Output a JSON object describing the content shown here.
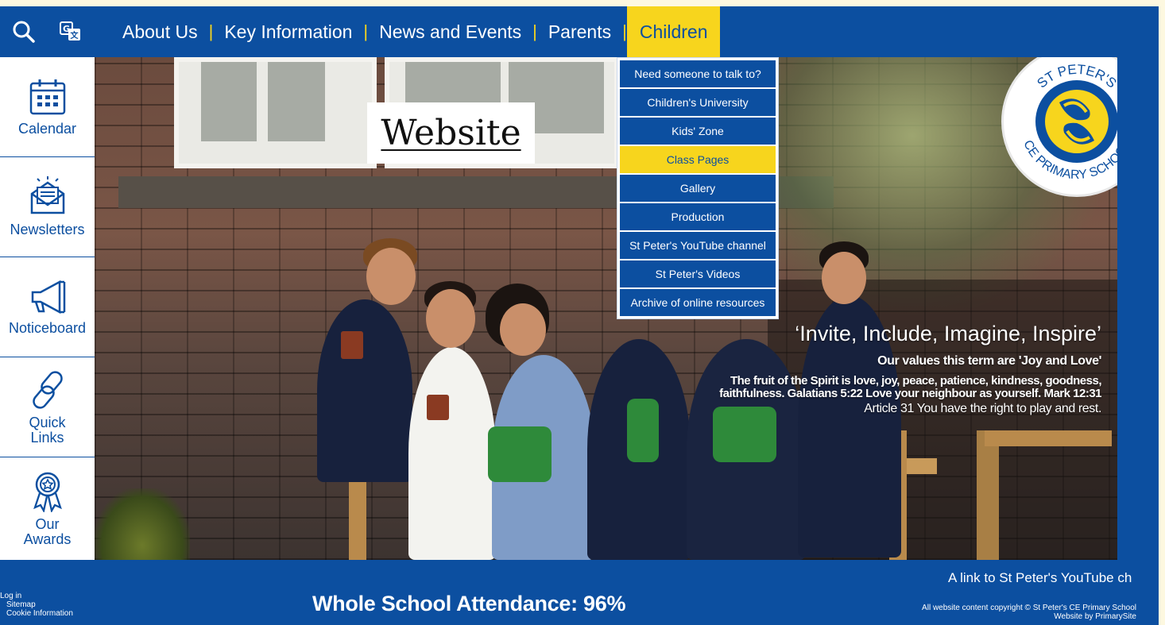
{
  "toolbar": {
    "search_icon": "search-icon",
    "translate_icon": "translate-icon"
  },
  "nav": {
    "items": [
      {
        "label": "About Us"
      },
      {
        "label": "Key Information"
      },
      {
        "label": "News and Events"
      },
      {
        "label": "Parents"
      },
      {
        "label": "Children",
        "active": true
      }
    ],
    "separator": "|"
  },
  "sidebar": {
    "items": [
      {
        "label": "Calendar",
        "icon": "calendar-icon"
      },
      {
        "label": "Newsletters",
        "icon": "newsletter-icon"
      },
      {
        "label": "Noticeboard",
        "icon": "megaphone-icon"
      },
      {
        "label_line1": "Quick",
        "label_line2": "Links",
        "icon": "link-icon"
      },
      {
        "label_line1": "Our",
        "label_line2": "Awards",
        "icon": "award-icon"
      }
    ]
  },
  "dropdown": {
    "items": [
      {
        "label": "Need someone to talk to?"
      },
      {
        "label": "Children's University"
      },
      {
        "label": "Kids' Zone"
      },
      {
        "label": "Class Pages",
        "active": true
      },
      {
        "label": "Gallery"
      },
      {
        "label": "Production"
      },
      {
        "label": "St Peter's YouTube channel"
      },
      {
        "label": "St Peter's Videos"
      },
      {
        "label": "Archive of online resources"
      }
    ]
  },
  "hero": {
    "website_label": "Website",
    "logo": {
      "top_text": "ST PETER'S",
      "bottom_text": "CE PRIMARY SCHOOL"
    },
    "headline": "‘Invite, Include, Imagine, Inspire’",
    "values": "Our values this term are 'Joy and Love'",
    "scripture_line1": "The fruit of the Spirit is love, joy, peace, patience, kindness, goodness,",
    "scripture_line2": "faithfulness. Galatians 5:22 Love your neighbour as yourself. Mark 12:31",
    "article": "Article 31 You have the right to play and rest."
  },
  "footer": {
    "marquee": "A link to St Peter's YouTube ch",
    "links": [
      "Log in",
      "Sitemap",
      "Cookie Information"
    ],
    "attendance": "Whole School Attendance: 96%",
    "copyright": "All website content copyright © St Peter's CE Primary School",
    "credit": "Website by PrimarySite"
  },
  "colors": {
    "brand_blue": "#0c4fa0",
    "accent_yellow": "#f7d51d"
  }
}
